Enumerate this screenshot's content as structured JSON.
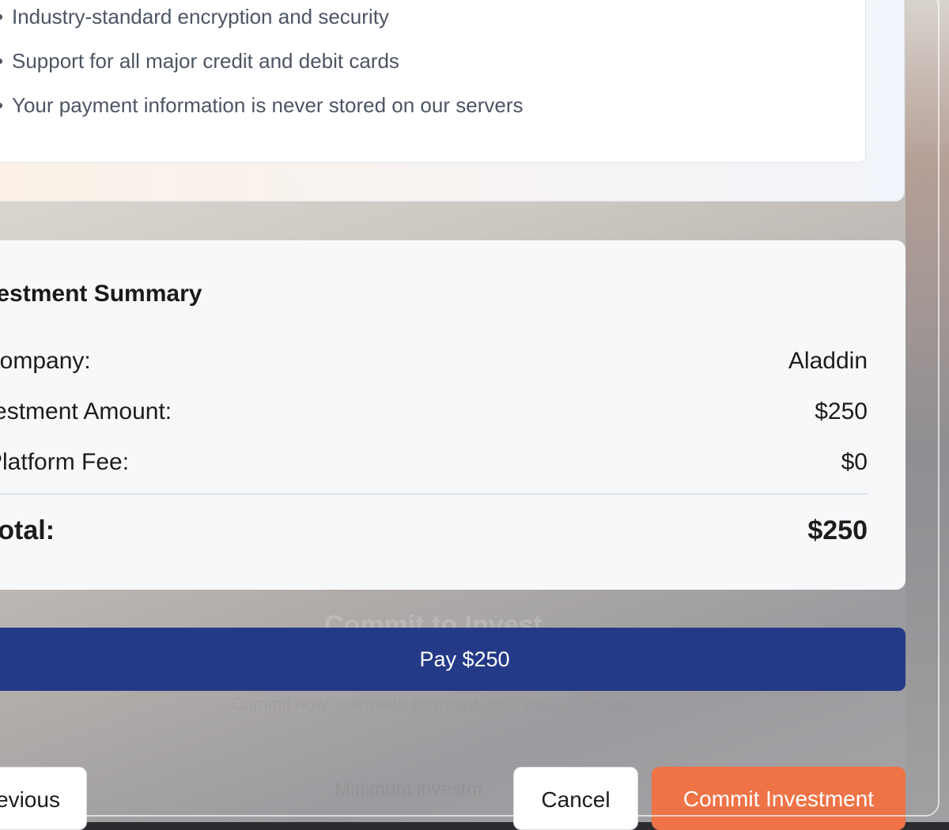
{
  "security": {
    "items": [
      "Industry-standard encryption and security",
      "Support for all major credit and debit cards",
      "Your payment information is never stored on our servers"
    ]
  },
  "summary": {
    "title": "Investment Summary",
    "rows": [
      {
        "label": "Company:",
        "value": "Aladdin"
      },
      {
        "label": "Investment Amount:",
        "value": "$250"
      },
      {
        "label": "Platform Fee:",
        "value": "$0"
      }
    ],
    "total_label": "Total:",
    "total_value": "$250"
  },
  "pay_button": "Pay $250",
  "background": {
    "title": "Commit to Invest",
    "subtitle": "Commit now, complete payment later via dashboard",
    "minimum_text": "Minimum investm"
  },
  "footer": {
    "previous_label": "Previous",
    "cancel_label": "Cancel",
    "commit_label": "Commit Investment"
  },
  "colors": {
    "pay_button": "#243a87",
    "commit_button": "#ee7347"
  }
}
